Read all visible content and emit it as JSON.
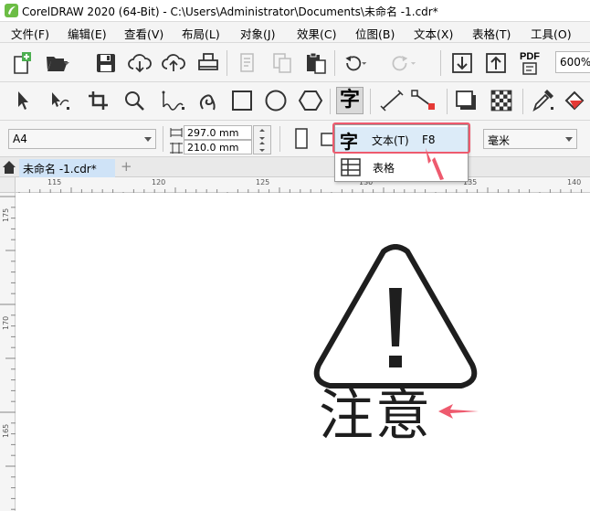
{
  "window": {
    "title": "CorelDRAW 2020 (64-Bit) - C:\\Users\\Administrator\\Documents\\未命名 -1.cdr*"
  },
  "menubar": {
    "items": [
      "文件(F)",
      "编辑(E)",
      "查看(V)",
      "布局(L)",
      "对象(J)",
      "效果(C)",
      "位图(B)",
      "文本(X)",
      "表格(T)",
      "工具(O)"
    ]
  },
  "standard_toolbar": {
    "zoom": "600%",
    "pdf_label": "PDF"
  },
  "property_bar": {
    "page_size": "A4",
    "width": "297.0 mm",
    "height": "210.0 mm",
    "units": "毫米"
  },
  "doc_tab": {
    "label": "未命名 -1.cdr*",
    "add_label": "+"
  },
  "ruler": {
    "h_labels": [
      "115",
      "120",
      "125",
      "130",
      "135",
      "140"
    ],
    "v_labels": [
      "175",
      "170",
      "165"
    ]
  },
  "popup": {
    "text_item": {
      "label": "文本(T)",
      "shortcut": "F8"
    },
    "table_item": {
      "label": "表格"
    }
  },
  "canvas": {
    "caption": "注意"
  },
  "colors": {
    "accent_red": "#ee5a6e",
    "menu_highlight": "#dcebf8",
    "tab_active": "#cfe3f7",
    "logo_green": "#6cbd45"
  },
  "icons": {
    "tool_text": "字"
  }
}
